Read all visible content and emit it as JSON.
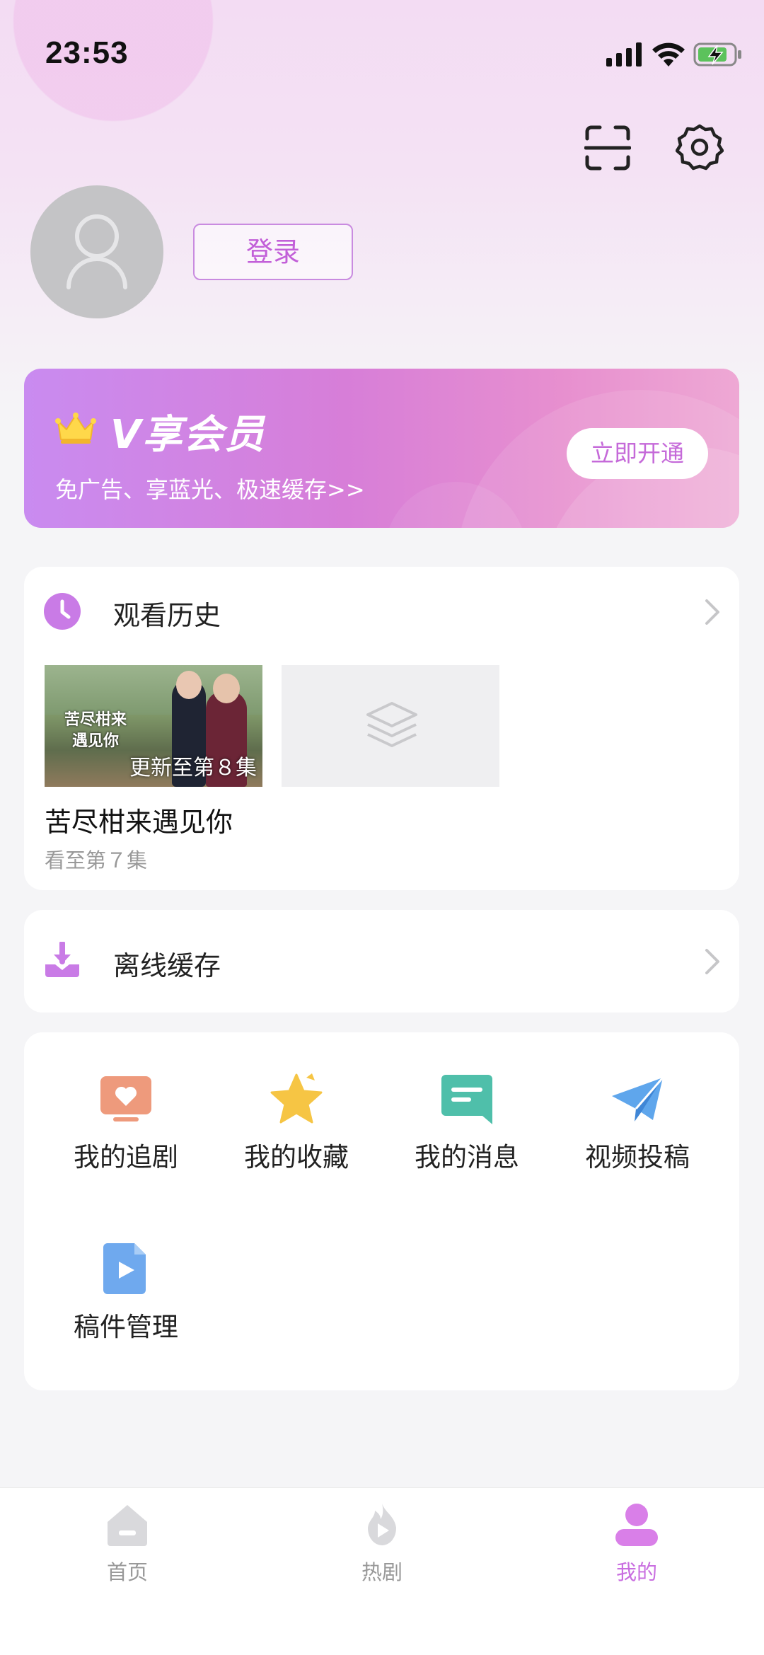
{
  "status_bar": {
    "time": "23:53"
  },
  "profile": {
    "login_label": "登录"
  },
  "vip": {
    "title": "V享会员",
    "subtitle": "免广告、享蓝光、极速缓存>>",
    "cta_label": "立即开通"
  },
  "history": {
    "title": "观看历史",
    "items": [
      {
        "poster_text": "苦尽柑来遇见你",
        "update_badge": "更新至第８集",
        "title": "苦尽柑来遇见你",
        "progress": "看至第７集"
      }
    ]
  },
  "offline": {
    "title": "离线缓存"
  },
  "features": [
    {
      "label": "我的追剧",
      "icon": "tv-heart-icon",
      "color": "#ee9a7c"
    },
    {
      "label": "我的收藏",
      "icon": "star-icon",
      "color": "#f6c544"
    },
    {
      "label": "我的消息",
      "icon": "message-icon",
      "color": "#4fbfaa"
    },
    {
      "label": "视频投稿",
      "icon": "paper-plane-icon",
      "color": "#5fa6ec"
    },
    {
      "label": "稿件管理",
      "icon": "video-file-icon",
      "color": "#6fa9ee"
    }
  ],
  "tabbar": {
    "tabs": [
      {
        "label": "首页",
        "icon": "home-icon",
        "active": false
      },
      {
        "label": "热剧",
        "icon": "flame-icon",
        "active": false
      },
      {
        "label": "我的",
        "icon": "user-icon",
        "active": true
      }
    ]
  },
  "colors": {
    "accent": "#c96ee0",
    "vip_gradient_start": "#c98bf0",
    "vip_gradient_end": "#eea8d4"
  }
}
